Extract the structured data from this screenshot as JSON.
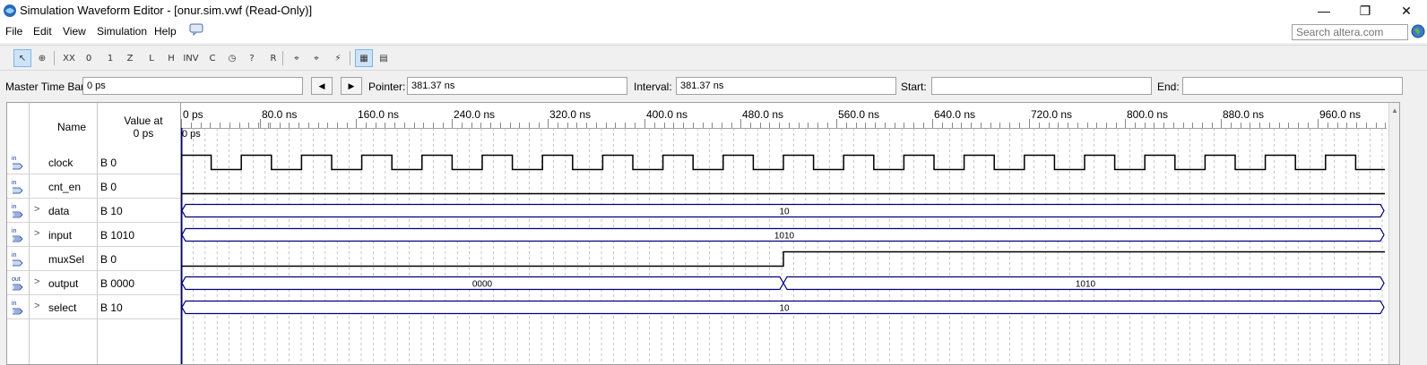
{
  "window": {
    "title": "Simulation Waveform Editor - [onur.sim.vwf (Read-Only)]",
    "minimize": "—",
    "maximize": "❐",
    "close": "✕"
  },
  "menu": {
    "items": [
      "File",
      "Edit",
      "View",
      "Simulation",
      "Help"
    ],
    "search_placeholder": "Search altera.com"
  },
  "toolbar": {
    "buttons": [
      {
        "icon": "selection-tool-icon",
        "glyph": "↖",
        "active": true
      },
      {
        "icon": "zoom-tool-icon",
        "glyph": "⊕"
      },
      {
        "icon": "forcing-unknown-icon",
        "glyph": "XX"
      },
      {
        "icon": "forcing-low-icon",
        "glyph": "0"
      },
      {
        "icon": "forcing-high-icon",
        "glyph": "1"
      },
      {
        "icon": "high-impedance-icon",
        "glyph": "Z"
      },
      {
        "icon": "weak-low-icon",
        "glyph": "L"
      },
      {
        "icon": "weak-high-icon",
        "glyph": "H"
      },
      {
        "icon": "invert-icon",
        "glyph": "INV"
      },
      {
        "icon": "count-value-icon",
        "glyph": "C"
      },
      {
        "icon": "clock-icon",
        "glyph": "◷"
      },
      {
        "icon": "arbitrary-value-icon",
        "glyph": "?"
      },
      {
        "icon": "random-value-icon",
        "glyph": "R"
      },
      {
        "icon": "snap-to-grid-icon",
        "glyph": "⌖"
      },
      {
        "icon": "snap-settings-icon",
        "glyph": "⌖"
      },
      {
        "icon": "functional-sim-icon",
        "glyph": "⚡"
      },
      {
        "icon": "grid-view-icon",
        "glyph": "▦",
        "active": true
      },
      {
        "icon": "list-view-icon",
        "glyph": "▤"
      }
    ]
  },
  "timebar": {
    "master_label": "Master Time Bar:",
    "master_value": "0 ps",
    "pointer_label": "Pointer:",
    "pointer_value": "381.37 ns",
    "interval_label": "Interval:",
    "interval_value": "381.37 ns",
    "start_label": "Start:",
    "start_value": "",
    "end_label": "End:",
    "end_value": ""
  },
  "grid": {
    "col_name": "Name",
    "col_value_line1": "Value at",
    "col_value_line2": "0 ps",
    "time_labels": [
      "0 ps",
      "80.0 ns",
      "160.0 ns",
      "240.0 ns",
      "320.0 ns",
      "400.0 ns",
      "480.0 ns",
      "560.0 ns",
      "640.0 ns",
      "720.0 ns",
      "800.0 ns",
      "880.0 ns",
      "960.0 ns"
    ],
    "cursor_label": "0 ps",
    "signals": [
      {
        "name": "clock",
        "value": "B 0",
        "dir": "in",
        "bus": false
      },
      {
        "name": "cnt_en",
        "value": "B 0",
        "dir": "in",
        "bus": false
      },
      {
        "name": "data",
        "value": "B 10",
        "dir": "in",
        "bus": true
      },
      {
        "name": "input",
        "value": "B 1010",
        "dir": "in",
        "bus": true
      },
      {
        "name": "muxSel",
        "value": "B 0",
        "dir": "in",
        "bus": false
      },
      {
        "name": "output",
        "value": "B 0000",
        "dir": "out",
        "bus": true
      },
      {
        "name": "select",
        "value": "B 10",
        "dir": "in",
        "bus": true
      }
    ],
    "bus_values": {
      "data": "10",
      "input": "1010",
      "output_before": "0000",
      "output_after": "1010",
      "select": "10"
    }
  },
  "colors": {
    "wave": "#000000",
    "bus": "#000080",
    "cursor": "#000080"
  }
}
